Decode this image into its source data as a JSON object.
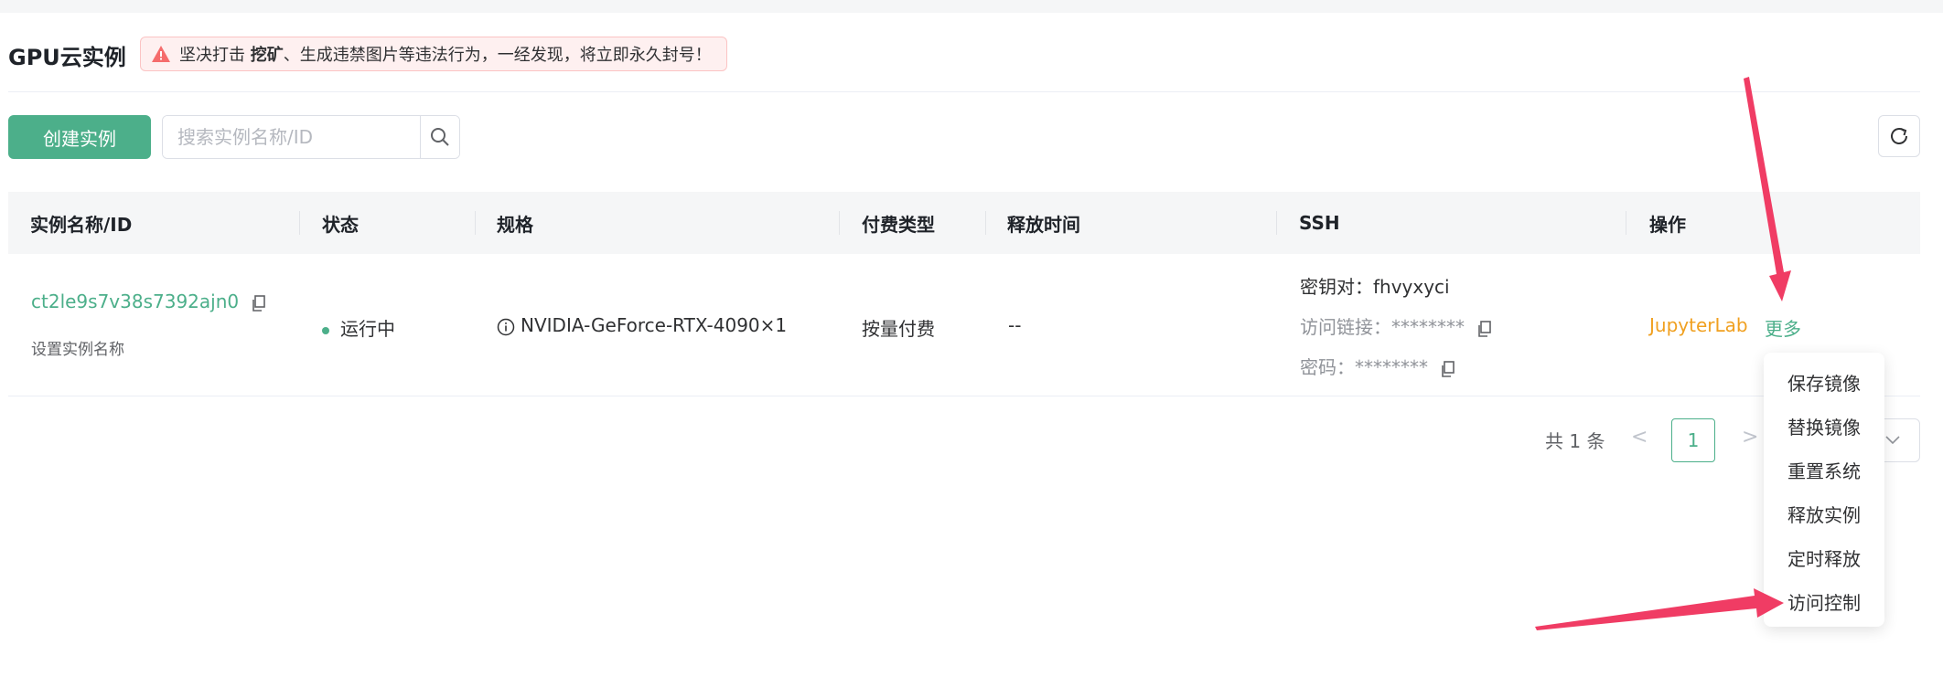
{
  "header": {
    "title": "GPU云实例",
    "warning_prefix": "坚决打击 ",
    "warning_bold": "挖矿",
    "warning_suffix": "、生成违禁图片等违法行为，一经发现，将立即永久封号！"
  },
  "toolbar": {
    "create_label": "创建实例",
    "search_placeholder": "搜索实例名称/ID"
  },
  "table": {
    "columns": [
      "实例名称/ID",
      "状态",
      "规格",
      "付费类型",
      "释放时间",
      "SSH",
      "操作"
    ],
    "rows": [
      {
        "instance_id": "ct2le9s7v38s7392ajn0",
        "set_name": "设置实例名称",
        "status": "运行中",
        "spec": "NVIDIA-GeForce-RTX-4090×1",
        "billing": "按量付费",
        "release_time": "--",
        "ssh_key": "密钥对：fhvyxyci",
        "ssh_link_label": "访问链接：",
        "ssh_link_value": "********",
        "ssh_password_label": "密码：",
        "ssh_password_value": "********",
        "action_jupyter": "JupyterLab",
        "action_more": "更多"
      }
    ]
  },
  "pagination": {
    "total": "共 1 条",
    "prev": "<",
    "current_page": "1",
    "next": ">"
  },
  "more_menu": {
    "items": [
      "保存镜像",
      "替换镜像",
      "重置系统",
      "释放实例",
      "定时释放",
      "访问控制"
    ]
  },
  "colors": {
    "accent": "#4caf8a",
    "warning": "#f56c6c",
    "jupyter": "#f0a020",
    "annotation_arrow": "#f03c64"
  },
  "icons": [
    "warning-icon",
    "search-icon",
    "refresh-icon",
    "copy-icon",
    "info-icon",
    "chevron-down-icon"
  ]
}
